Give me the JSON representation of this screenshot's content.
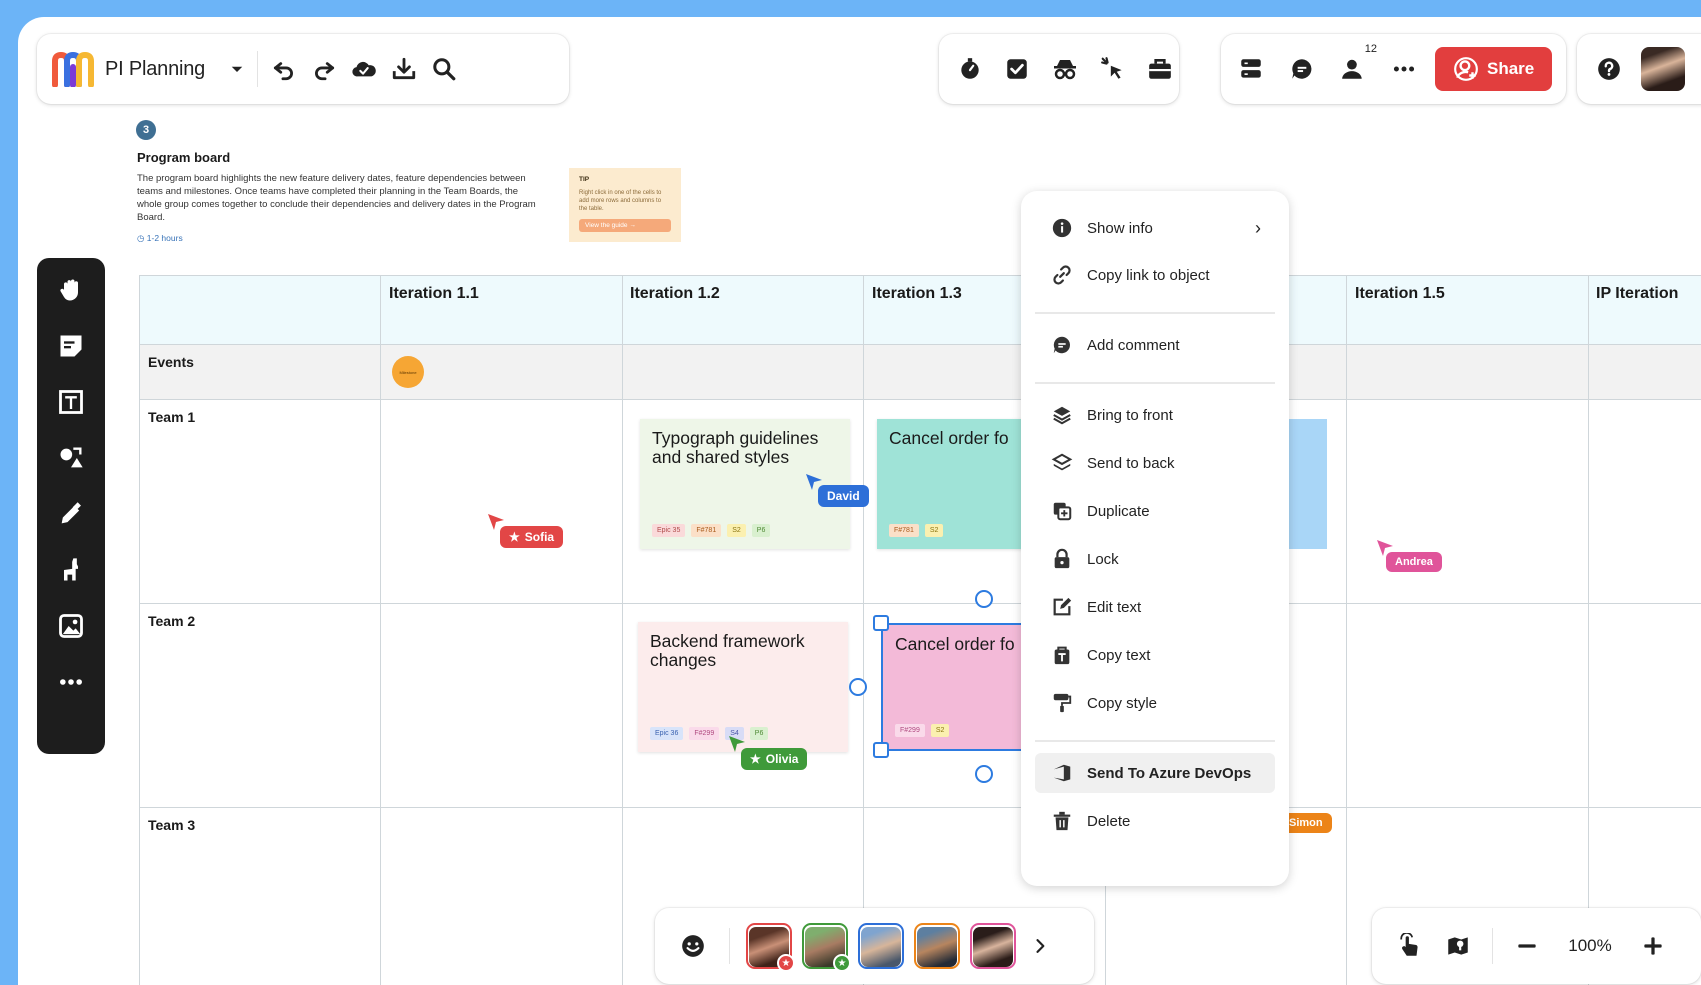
{
  "toolbar": {
    "board_title": "PI Planning",
    "share_label": "Share",
    "collaborator_count": "12"
  },
  "intro": {
    "step": "3",
    "title": "Program board",
    "description": "The program board highlights the new feature delivery dates, feature dependencies between teams and milestones. Once teams have completed their planning in the Team Boards, the whole group comes together to conclude their dependencies and delivery dates in the Program Board.",
    "duration": "1-2 hours",
    "tip": {
      "label": "TIP",
      "text": "Right click in one of the cells to add more rows and columns to the table.",
      "button": "View the guide"
    }
  },
  "grid": {
    "columns": [
      "Iteration 1.1",
      "Iteration 1.2",
      "Iteration 1.3",
      "Iteration 1.5",
      "IP Iteration"
    ],
    "rows": [
      "Events",
      "Team 1",
      "Team 2",
      "Team 3"
    ],
    "milestone": "Milestone"
  },
  "cards": {
    "typograph": {
      "title": "Typograph guidelines and shared styles",
      "chips": [
        "Epic 35",
        "F#781",
        "S2",
        "P6"
      ]
    },
    "cancel1": {
      "title": "Cancel order fo",
      "chips": [
        "F#781",
        "S2"
      ]
    },
    "backend": {
      "title": "Backend framework changes",
      "chips": [
        "Epic 36",
        "F#299",
        "S4",
        "P6"
      ]
    },
    "cancel2": {
      "title": "Cancel order fo",
      "chips": [
        "F#299",
        "S2"
      ]
    }
  },
  "cursors": {
    "sofia": "Sofia",
    "david": "David",
    "olivia": "Olivia",
    "andrea": "Andrea",
    "simon": "Simon"
  },
  "context_menu": {
    "items": [
      "Show info",
      "Copy link to object",
      "Add comment",
      "Bring to front",
      "Send to back",
      "Duplicate",
      "Lock",
      "Edit text",
      "Copy text",
      "Copy style",
      "Send To Azure DevOps",
      "Delete"
    ]
  },
  "zoom": {
    "level": "100%"
  },
  "colors": {
    "brand_red": "#e23e3e",
    "selection_blue": "#2d7be0",
    "background_blue": "#6cb4f7"
  }
}
